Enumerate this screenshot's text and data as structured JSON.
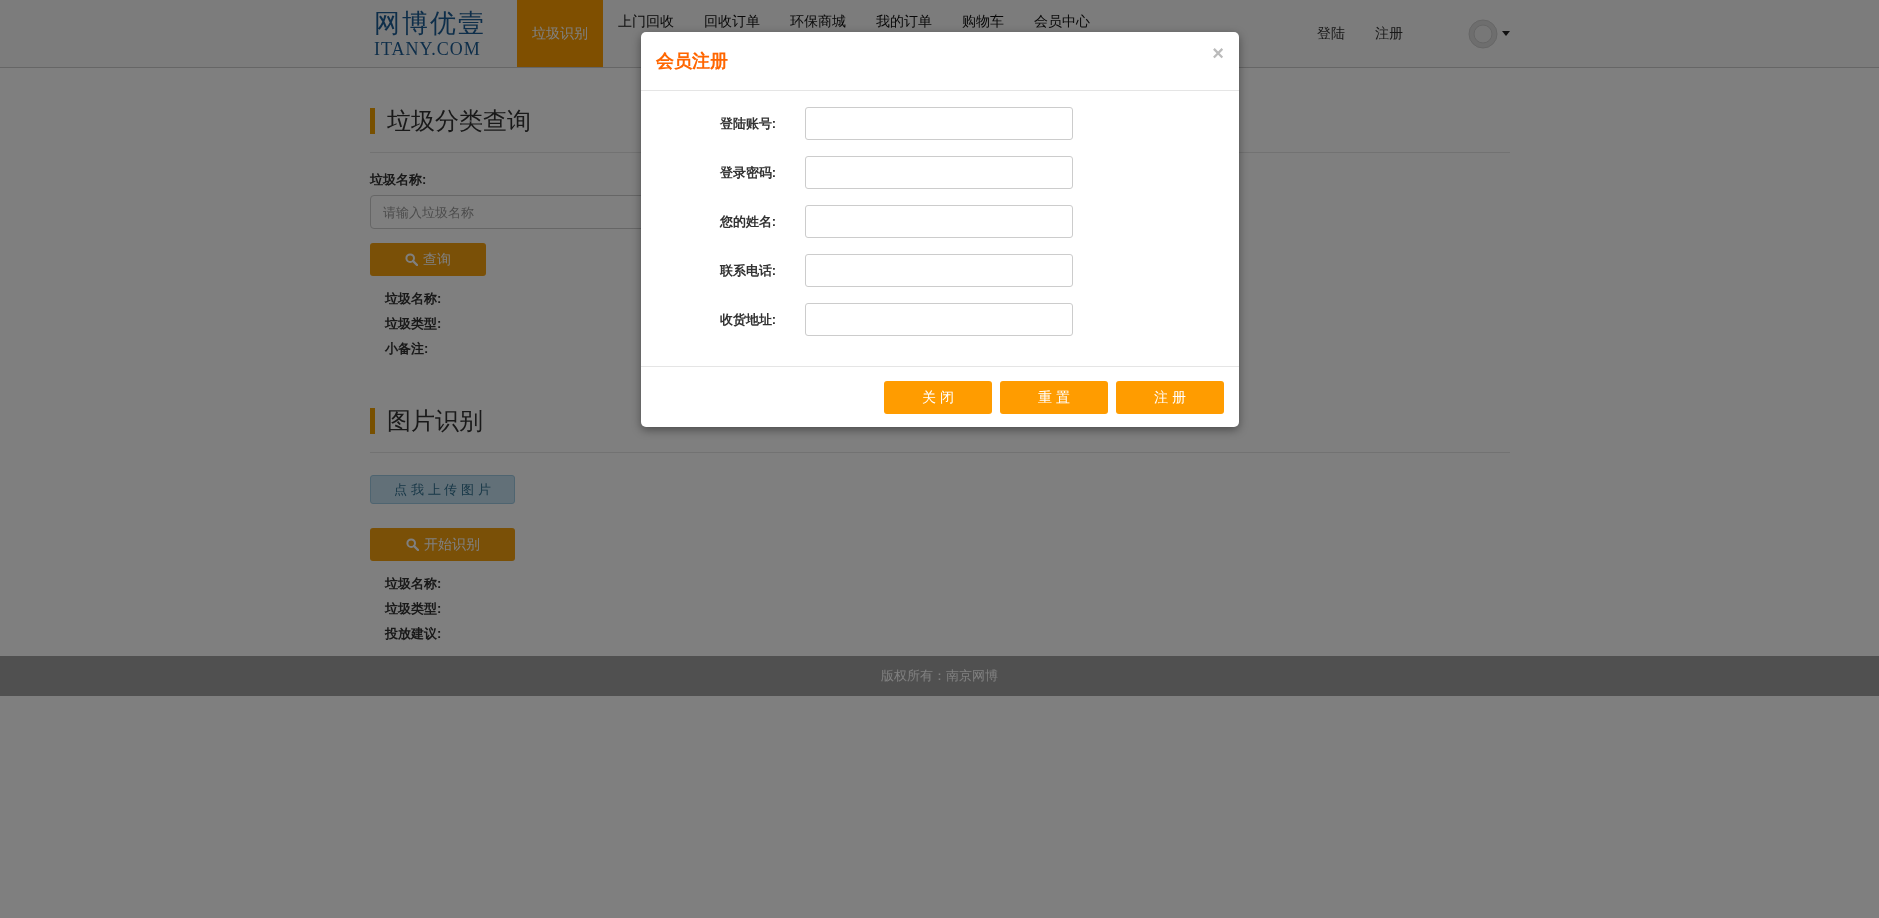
{
  "navbar": {
    "logo": {
      "title": "网博优壹",
      "subtitle": "ITANY.COM"
    },
    "menu": [
      {
        "label": "垃圾识别",
        "selected": true
      },
      {
        "label": "上门回收",
        "selected": false
      },
      {
        "label": "回收订单",
        "selected": false
      },
      {
        "label": "环保商城",
        "selected": false
      },
      {
        "label": "我的订单",
        "selected": false
      },
      {
        "label": "购物车",
        "selected": false
      },
      {
        "label": "会员中心",
        "selected": false
      }
    ],
    "auth_links": [
      "登陆",
      "注册"
    ]
  },
  "query_section": {
    "title": "垃圾分类查询",
    "field_label": "垃圾名称:",
    "placeholder": "请输入垃圾名称",
    "button": "查询",
    "results": [
      "垃圾名称:",
      "垃圾类型:",
      "小备注:"
    ]
  },
  "image_section": {
    "title": "图片识别",
    "upload_button": "点 我 上 传 图 片",
    "button": "开始识别",
    "results": [
      "垃圾名称:",
      "垃圾类型:",
      "投放建议:"
    ]
  },
  "footer": "版权所有：南京网博",
  "modal": {
    "title": "会员注册",
    "close": "×",
    "fields": [
      {
        "label": "登陆账号:"
      },
      {
        "label": "登录密码:"
      },
      {
        "label": "您的姓名:"
      },
      {
        "label": "联系电话:"
      },
      {
        "label": "收货地址:"
      }
    ],
    "buttons": [
      "关 闭",
      "重 置",
      "注 册"
    ]
  }
}
